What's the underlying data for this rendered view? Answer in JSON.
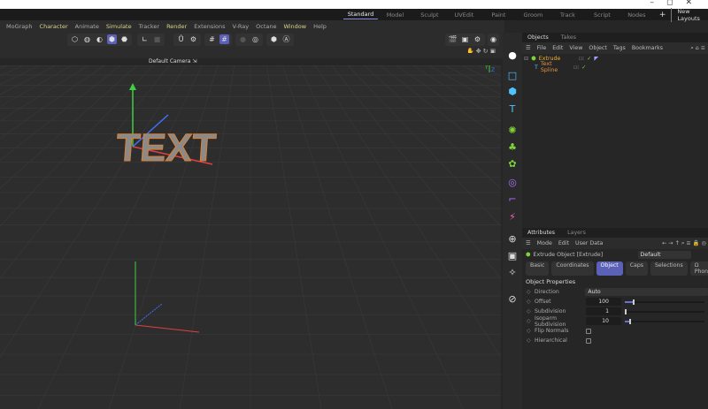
{
  "window_controls": [
    "–",
    "◻",
    "✕"
  ],
  "layouts": {
    "tabs": [
      "Standard",
      "Model",
      "Sculpt",
      "UVEdit",
      "Paint",
      "Groom",
      "Track",
      "Script",
      "Nodes"
    ],
    "active": "Standard",
    "plus": "+",
    "new_layouts": "New Layouts"
  },
  "menu": [
    {
      "label": "MoGraph",
      "hl": false
    },
    {
      "label": "Character",
      "hl": true
    },
    {
      "label": "Animate",
      "hl": false
    },
    {
      "label": "Simulate",
      "hl": true
    },
    {
      "label": "Tracker",
      "hl": false
    },
    {
      "label": "Render",
      "hl": true
    },
    {
      "label": "Extensions",
      "hl": false
    },
    {
      "label": "V-Ray",
      "hl": false
    },
    {
      "label": "Octane",
      "hl": false
    },
    {
      "label": "Window",
      "hl": true
    },
    {
      "label": "Help",
      "hl": false
    }
  ],
  "viewport": {
    "camera": "Default Camera",
    "camera_icon": "⇲",
    "object_text": "TEXT",
    "axis_y": "Y",
    "axis_z": "Z"
  },
  "objects": {
    "tabs": [
      "Objects",
      "Takes"
    ],
    "active_tab": "Objects",
    "menu": [
      "File",
      "Edit",
      "View",
      "Object",
      "Tags",
      "Bookmarks"
    ],
    "items": [
      {
        "name": "Extrude",
        "color": "#f0b030",
        "depth": 0
      },
      {
        "name": "Text Spline",
        "color": "#e89040",
        "depth": 1
      }
    ]
  },
  "attributes": {
    "tabs": [
      "Attributes",
      "Layers"
    ],
    "active_tab": "Attributes",
    "menu": [
      "Mode",
      "Edit",
      "User Data"
    ],
    "object_title": "Extrude Object [Extrude]",
    "preset": "Default",
    "subtabs": [
      "Basic",
      "Coordinates",
      "Object",
      "Caps",
      "Selections",
      "Ω Phong"
    ],
    "active_subtab": "Object",
    "section": "Object Properties",
    "props": [
      {
        "label": "Direction",
        "value": "Auto",
        "type": "dropdown"
      },
      {
        "label": "Offset",
        "value": "100 cm",
        "type": "slider",
        "fill": 0.1
      },
      {
        "label": "Subdivision",
        "value": "1",
        "type": "slider",
        "fill": 0
      },
      {
        "label": "Isoparm Subdivision",
        "value": "10",
        "type": "slider",
        "fill": 0.05
      },
      {
        "label": "Flip Normals",
        "type": "checkbox",
        "checked": false
      },
      {
        "label": "Hierarchical",
        "type": "checkbox",
        "checked": false
      }
    ]
  },
  "colors": {
    "accent": "#5a61b7",
    "highlight_menu": "#d7d38a",
    "icon_blue": "#4fc3ff"
  }
}
